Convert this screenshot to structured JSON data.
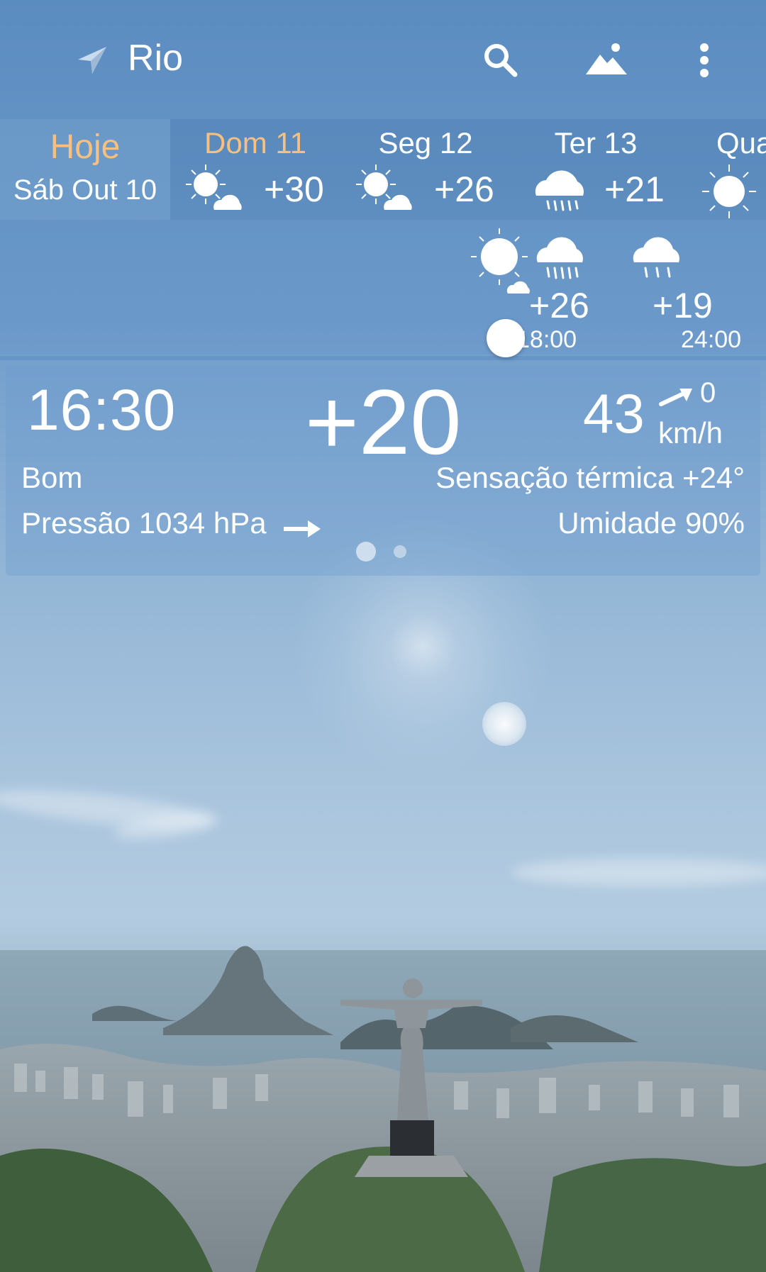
{
  "header": {
    "city": "Rio",
    "icons": [
      "location-arrow-icon",
      "search-icon",
      "landscape-icon",
      "more-vert-icon"
    ]
  },
  "days": [
    {
      "name": "Hoje",
      "date": "Sáb Out 10"
    },
    {
      "name": "Dom 11",
      "temp": "+30",
      "icon": "sun-cloud-icon"
    },
    {
      "name": "Seg 12",
      "temp": "+26",
      "icon": "sun-cloud-icon"
    },
    {
      "name": "Ter 13",
      "temp": "+21",
      "icon": "rain-cloud-icon"
    },
    {
      "name": "Qua",
      "icon": "sun-icon"
    }
  ],
  "hourly": [
    {
      "temp": "+26",
      "time": "18:00"
    },
    {
      "temp": "+19",
      "time": "24:00"
    }
  ],
  "current": {
    "time": "16:30",
    "temp": "+20",
    "wind_dir_value": "43",
    "wind_speed": "0",
    "wind_unit": "km/h",
    "condition": "Bom",
    "feels_like": "Sensação térmica +24°",
    "pressure": "Pressão 1034 hPa",
    "humidity": "Umidade 90%"
  },
  "pager": {
    "pages": 2,
    "active": 0
  },
  "colors": {
    "accent_today": "#f7c081"
  }
}
